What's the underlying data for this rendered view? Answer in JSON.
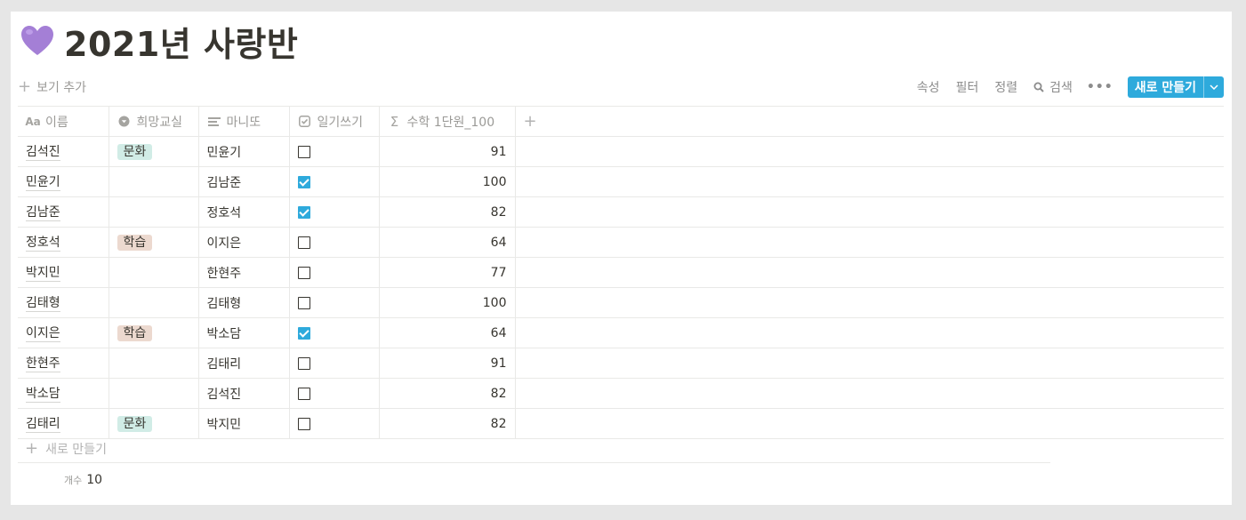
{
  "page": {
    "title": "2021년 사랑반",
    "icon": "purple-heart-icon"
  },
  "toolbar": {
    "add_view": "보기 추가",
    "properties": "속성",
    "filter": "필터",
    "sort": "정렬",
    "search": "검색",
    "more": "•••",
    "new_button": "새로 만들기"
  },
  "table": {
    "columns": [
      {
        "label": "이름",
        "icon": "aa-text-icon"
      },
      {
        "label": "희망교실",
        "icon": "select-icon"
      },
      {
        "label": "마니또",
        "icon": "text-lines-icon"
      },
      {
        "label": "일기쓰기",
        "icon": "checkbox-icon"
      },
      {
        "label": "수학 1단원_100",
        "icon": "sigma-icon"
      }
    ],
    "rows": [
      {
        "name": "김석진",
        "room": "문화",
        "manito": "민윤기",
        "diary": false,
        "math": "91"
      },
      {
        "name": "민윤기",
        "room": "",
        "manito": "김남준",
        "diary": true,
        "math": "100"
      },
      {
        "name": "김남준",
        "room": "",
        "manito": "정호석",
        "diary": true,
        "math": "82"
      },
      {
        "name": "정호석",
        "room": "학습",
        "manito": "이지은",
        "diary": false,
        "math": "64"
      },
      {
        "name": "박지민",
        "room": "",
        "manito": "한현주",
        "diary": false,
        "math": "77"
      },
      {
        "name": "김태형",
        "room": "",
        "manito": "김태형",
        "diary": false,
        "math": "100"
      },
      {
        "name": "이지은",
        "room": "학습",
        "manito": "박소담",
        "diary": true,
        "math": "64"
      },
      {
        "name": "한현주",
        "room": "",
        "manito": "김태리",
        "diary": false,
        "math": "91"
      },
      {
        "name": "박소담",
        "room": "",
        "manito": "김석진",
        "diary": false,
        "math": "82"
      },
      {
        "name": "김태리",
        "room": "문화",
        "manito": "박지민",
        "diary": false,
        "math": "82"
      }
    ],
    "new_row": "새로 만들기",
    "count_label": "개수",
    "count_value": "10"
  },
  "colors": {
    "accent": "#2eaadc",
    "tag_culture": "#d1ece6",
    "tag_study": "#ecd9cf",
    "heart": "#a47fd6"
  }
}
